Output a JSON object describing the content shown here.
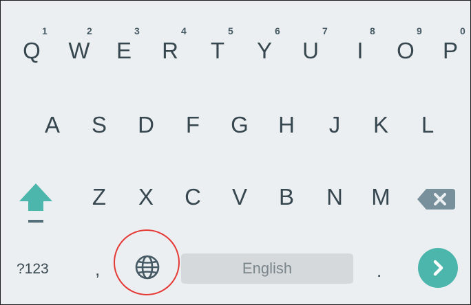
{
  "keyboard": {
    "row1": [
      {
        "letter": "Q",
        "hint": "1"
      },
      {
        "letter": "W",
        "hint": "2"
      },
      {
        "letter": "E",
        "hint": "3"
      },
      {
        "letter": "R",
        "hint": "4"
      },
      {
        "letter": "T",
        "hint": "5"
      },
      {
        "letter": "Y",
        "hint": "6"
      },
      {
        "letter": "U",
        "hint": "7"
      },
      {
        "letter": "I",
        "hint": "8"
      },
      {
        "letter": "O",
        "hint": "9"
      },
      {
        "letter": "P",
        "hint": "0"
      }
    ],
    "row2": [
      "A",
      "S",
      "D",
      "F",
      "G",
      "H",
      "J",
      "K",
      "L"
    ],
    "row3": [
      "Z",
      "X",
      "C",
      "V",
      "B",
      "N",
      "M"
    ],
    "row4": {
      "symbols_label": "?123",
      "comma_label": ",",
      "space_label": "English",
      "period_label": "."
    },
    "icons": {
      "shift": "shift-arrow-icon",
      "backspace": "backspace-icon",
      "globe": "globe-icon",
      "enter": "chevron-right-icon"
    },
    "colors": {
      "background": "#eceff1",
      "key_text": "#37474f",
      "accent": "#4db6ac",
      "highlight_circle": "#e53935"
    }
  }
}
